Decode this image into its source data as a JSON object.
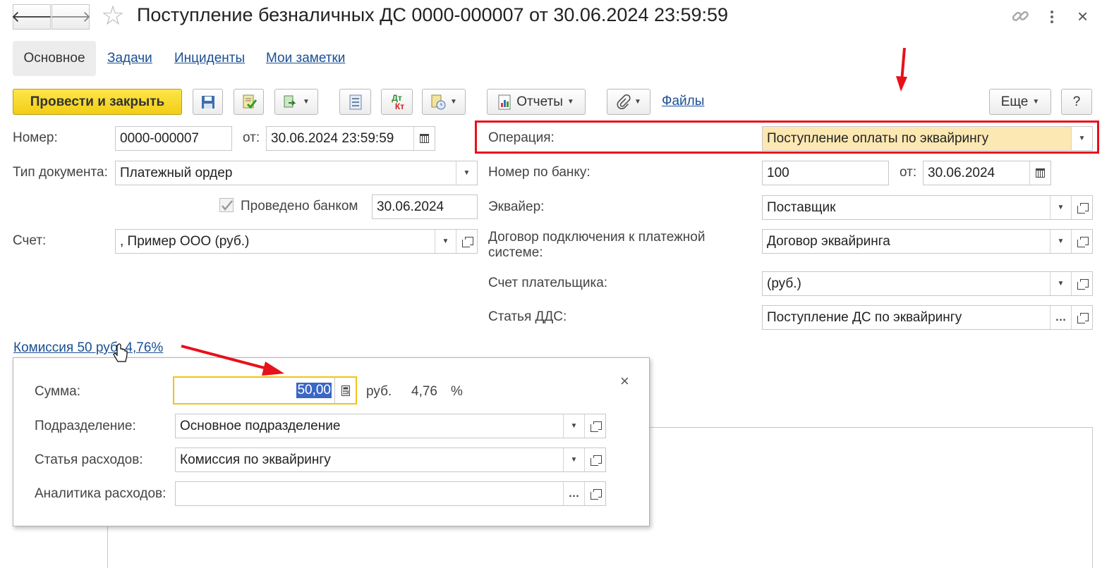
{
  "window": {
    "title": "Поступление безналичных ДС 0000-000007 от 30.06.2024 23:59:59",
    "actions": {
      "link_icon": "link-icon",
      "more_icon": "vertical-dots-icon",
      "close": "×"
    }
  },
  "nav": {
    "back": "🡐",
    "forward": "🡒",
    "star": "☆"
  },
  "tabs": [
    {
      "label": "Основное",
      "active": true
    },
    {
      "label": "Задачи"
    },
    {
      "label": "Инциденты"
    },
    {
      "label": "Мои заметки"
    }
  ],
  "toolbar": {
    "post_close": "Провести и закрыть",
    "dtkt_top": "Дт",
    "dtkt_bottom": "Кт",
    "reports": "Отчеты",
    "files": "Файлы",
    "more": "Еще",
    "help": "?"
  },
  "form": {
    "number_label": "Номер:",
    "number_value": "0000-000007",
    "date_from_label": "от:",
    "date_value": "30.06.2024 23:59:59",
    "doc_type_label": "Тип документа:",
    "doc_type_value": "Платежный ордер",
    "bank_posted_label": "Проведено банком",
    "bank_posted_checked": true,
    "bank_posted_date": "30.06.2024",
    "account_label": "Счет:",
    "account_value": ", Пример ООО (руб.)",
    "operation_label": "Операция:",
    "operation_value": "Поступление оплаты по эквайрингу",
    "bank_number_label": "Номер по банку:",
    "bank_number_value": "100",
    "bank_date_label": "от:",
    "bank_date_value": "30.06.2024",
    "acquirer_label": "Эквайер:",
    "acquirer_value": "Поставщик",
    "contract_label": "Договор подключения к платежной системе:",
    "contract_value": "Договор эквайринга",
    "payer_account_label": "Счет плательщика:",
    "payer_account_value": "(руб.)",
    "dds_label": "Статья ДДС:",
    "dds_value": "Поступление ДС по эквайрингу",
    "commission_link": "Комиссия 50 руб. 4,76%"
  },
  "popup": {
    "close": "×",
    "sum_label": "Сумма:",
    "sum_value": "50,00",
    "currency": "руб.",
    "percent_value": "4,76",
    "percent_sign": "%",
    "division_label": "Подразделение:",
    "division_value": "Основное подразделение",
    "expense_label": "Статья расходов:",
    "expense_value": "Комиссия по эквайрингу",
    "analytics_label": "Аналитика расходов:",
    "analytics_value": ""
  },
  "colors": {
    "annotation_red": "#e8101a",
    "primary_yellow": "#f6d520",
    "highlight_field": "#fce8b2",
    "link_blue": "#1a4f93"
  }
}
